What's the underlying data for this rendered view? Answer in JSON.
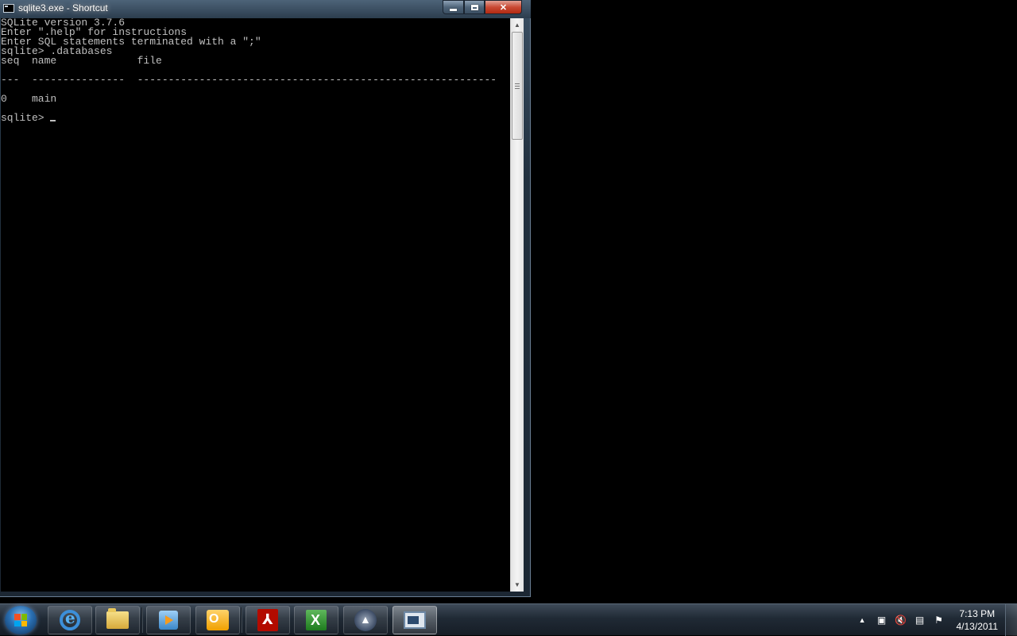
{
  "window": {
    "title": "sqlite3.exe - Shortcut",
    "caption_buttons": {
      "minimize": "minimize",
      "maximize": "restore",
      "close": "✕"
    }
  },
  "console": {
    "lines": [
      "SQLite version 3.7.6",
      "Enter \".help\" for instructions",
      "Enter SQL statements terminated with a \";\"",
      "sqlite> .databases",
      "seq  name             file",
      "",
      "---  ---------------  ----------------------------------------------------------",
      "",
      "0    main",
      "",
      "sqlite> "
    ]
  },
  "taskbar": {
    "apps": [
      {
        "name": "Internet Explorer",
        "icon": "ie-icon"
      },
      {
        "name": "Windows Explorer",
        "icon": "folder-icon"
      },
      {
        "name": "Windows Media Player",
        "icon": "media-player-icon"
      },
      {
        "name": "Outlook",
        "icon": "outlook-icon"
      },
      {
        "name": "Adobe Reader",
        "icon": "pdf-icon"
      },
      {
        "name": "Excel",
        "icon": "excel-icon"
      },
      {
        "name": "App",
        "icon": "app-icon"
      },
      {
        "name": "sqlite3.exe - Shortcut",
        "icon": "console-icon",
        "active": true
      }
    ],
    "tray": {
      "show_hidden": "▲",
      "icons": [
        "device-icon",
        "volume-muted-icon",
        "network-icon",
        "action-center-icon"
      ]
    },
    "clock": {
      "time": "7:13 PM",
      "date": "4/13/2011"
    }
  },
  "colors": {
    "console_bg": "#000000",
    "console_text": "#c0c0c0",
    "close_button": "#c94a34"
  }
}
